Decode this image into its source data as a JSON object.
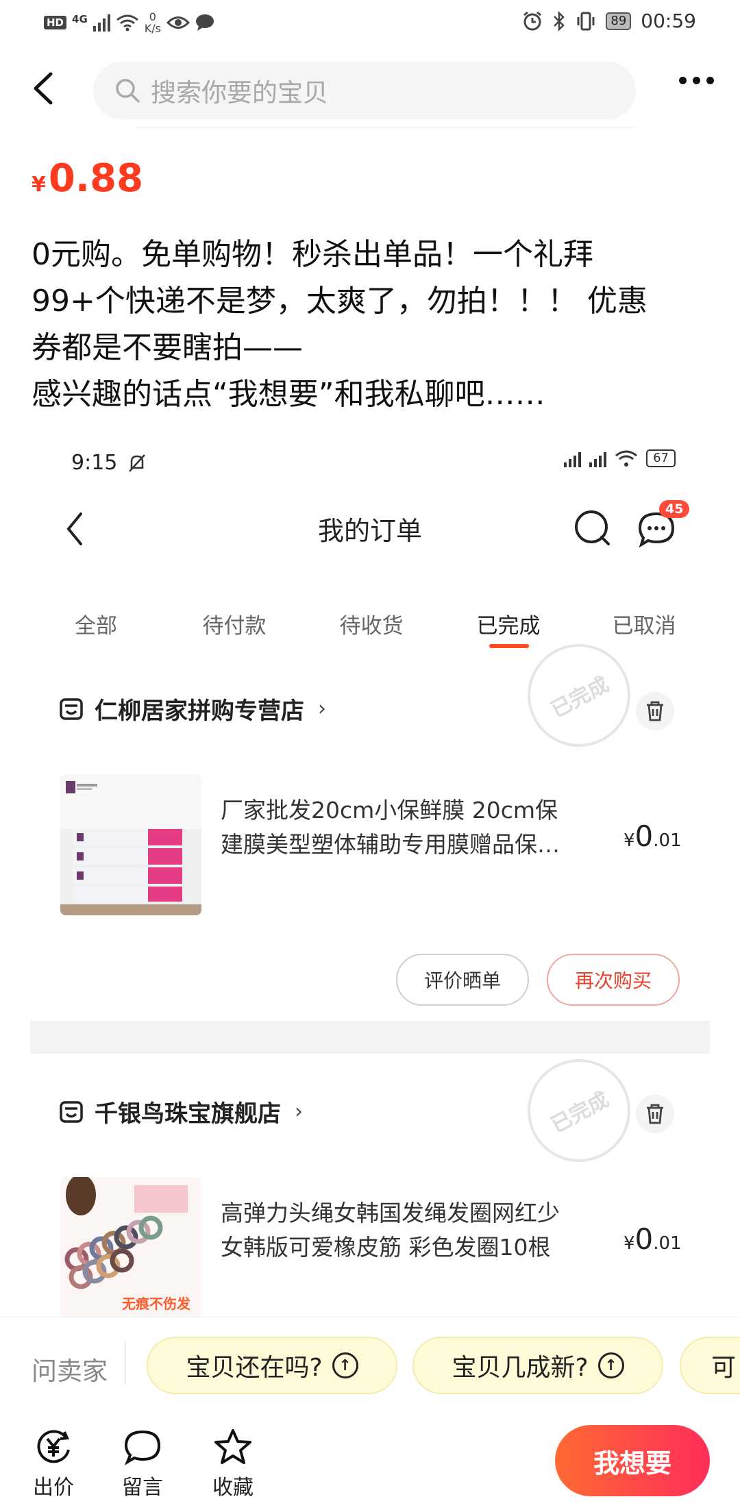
{
  "status_bar": {
    "hd": "HD",
    "net": "4G",
    "speed_value": "0",
    "speed_unit": "K/s",
    "battery": "89",
    "time": "00:59"
  },
  "search": {
    "placeholder": "搜索你要的宝贝"
  },
  "listing": {
    "currency": "¥",
    "price": "0.88",
    "description_lines": [
      "0元购。免单购物！秒杀出单品！一个礼拜",
      "99+个快递不是梦，太爽了，勿拍！！！ 优惠",
      "券都是不要瞎拍——",
      "感兴趣的话点“我想要”和我私聊吧……"
    ]
  },
  "embedded_screenshot": {
    "time": "9:15",
    "battery": "67",
    "title": "我的订单",
    "message_badge": "45",
    "tabs": [
      "全部",
      "待付款",
      "待收货",
      "已完成",
      "已取消"
    ],
    "active_tab": "已完成",
    "orders": [
      {
        "store": "仁柳居家拼购专营店",
        "stamp": "已完成",
        "title_lines": [
          "厂家批发20cm小保鲜膜 20cm保",
          "建膜美型塑体辅助专用膜赠品保…"
        ],
        "currency": "¥",
        "price_main": "0",
        "price_decimal": ".01",
        "buttons": [
          "评价晒单",
          "再次购买"
        ]
      },
      {
        "store": "千银鸟珠宝旗舰店",
        "stamp": "已完成",
        "title_lines": [
          "高弹力头绳女韩国发绳发圈网红少",
          "女韩版可爱橡皮筋 彩色发圈10根"
        ],
        "currency": "¥",
        "price_main": "0",
        "price_decimal": ".01",
        "thumb_caption": "无痕不伤发"
      }
    ]
  },
  "questions": {
    "label": "问卖家",
    "chips": [
      "宝贝还在吗?",
      "宝贝几成新?",
      "可"
    ]
  },
  "bottom_bar": {
    "actions": [
      {
        "label": "出价",
        "icon": "yuan-circle-icon"
      },
      {
        "label": "留言",
        "icon": "chat-bubble-icon"
      },
      {
        "label": "收藏",
        "icon": "star-icon"
      }
    ],
    "primary_button": "我想要"
  },
  "colors": {
    "price_red": "#ff3b1f",
    "accent_orange": "#ff4a1f",
    "chip_bg": "#fffbd8",
    "want_gradient_start": "#ff6a33",
    "want_gradient_end": "#ff2d5a"
  }
}
